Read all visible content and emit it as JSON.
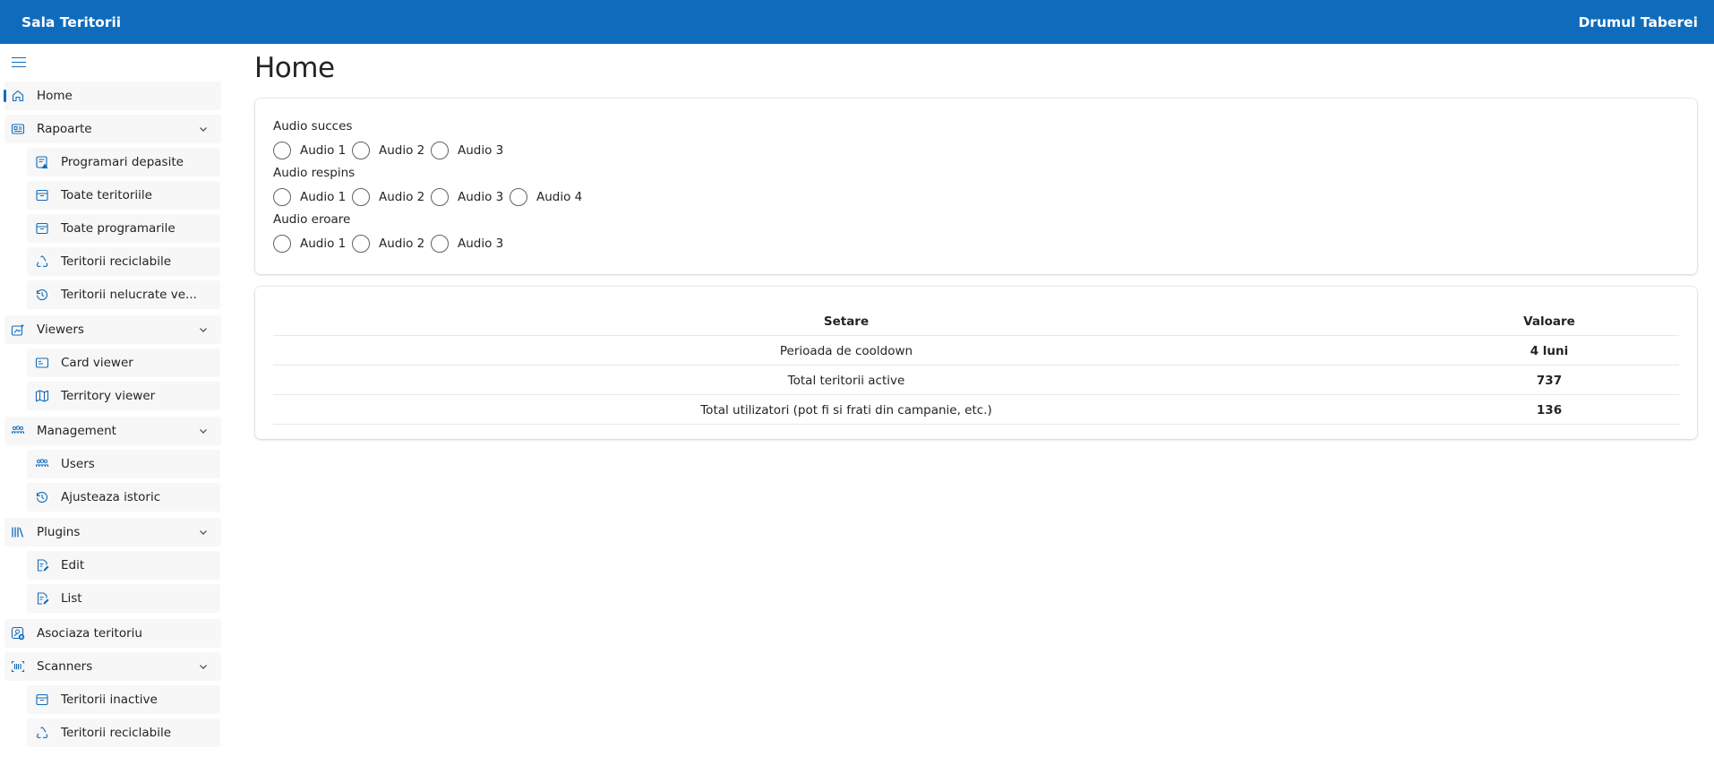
{
  "header": {
    "app_title": "Sala Teritorii",
    "user_name": "Drumul Taberei"
  },
  "sidebar": {
    "items": [
      {
        "label": "Home",
        "icon": "home-icon",
        "active": true
      },
      {
        "label": "Rapoarte",
        "icon": "report-icon",
        "expandable": true
      },
      {
        "label": "Programari depasite",
        "icon": "calendar-warning-icon"
      },
      {
        "label": "Toate teritoriile",
        "icon": "archive-icon"
      },
      {
        "label": "Toate programarile",
        "icon": "archive-icon"
      },
      {
        "label": "Teritorii reciclabile",
        "icon": "recycle-icon"
      },
      {
        "label": "Teritorii nelucrate ve...",
        "icon": "history-icon"
      },
      {
        "label": "Viewers",
        "icon": "viewers-icon",
        "expandable": true
      },
      {
        "label": "Card viewer",
        "icon": "card-icon"
      },
      {
        "label": "Territory viewer",
        "icon": "map-icon"
      },
      {
        "label": "Management",
        "icon": "people-icon",
        "expandable": true
      },
      {
        "label": "Users",
        "icon": "people-icon"
      },
      {
        "label": "Ajusteaza istoric",
        "icon": "history-icon"
      },
      {
        "label": "Plugins",
        "icon": "library-icon",
        "expandable": true
      },
      {
        "label": "Edit",
        "icon": "document-edit-icon"
      },
      {
        "label": "List",
        "icon": "document-edit-icon"
      },
      {
        "label": "Asociaza teritoriu",
        "icon": "person-add-icon"
      },
      {
        "label": "Scanners",
        "icon": "barcode-icon",
        "expandable": true
      },
      {
        "label": "Teritorii inactive",
        "icon": "archive-icon"
      },
      {
        "label": "Teritorii reciclabile",
        "icon": "recycle-icon"
      }
    ]
  },
  "main": {
    "title": "Home",
    "audio_groups": [
      {
        "label": "Audio succes",
        "options": [
          "Audio 1",
          "Audio 2",
          "Audio 3"
        ]
      },
      {
        "label": "Audio respins",
        "options": [
          "Audio 1",
          "Audio 2",
          "Audio 3",
          "Audio 4"
        ]
      },
      {
        "label": "Audio eroare",
        "options": [
          "Audio 1",
          "Audio 2",
          "Audio 3"
        ]
      }
    ],
    "settings_table": {
      "headers": [
        "Setare",
        "Valoare"
      ],
      "rows": [
        [
          "Perioada de cooldown",
          "4 luni"
        ],
        [
          "Total teritorii active",
          "737"
        ],
        [
          "Total utilizatori (pot fi si frati din campanie, etc.)",
          "136"
        ]
      ]
    }
  },
  "colors": {
    "brand": "#0f6cbd",
    "nav_bg": "#f7f7f7",
    "text": "#242424"
  }
}
